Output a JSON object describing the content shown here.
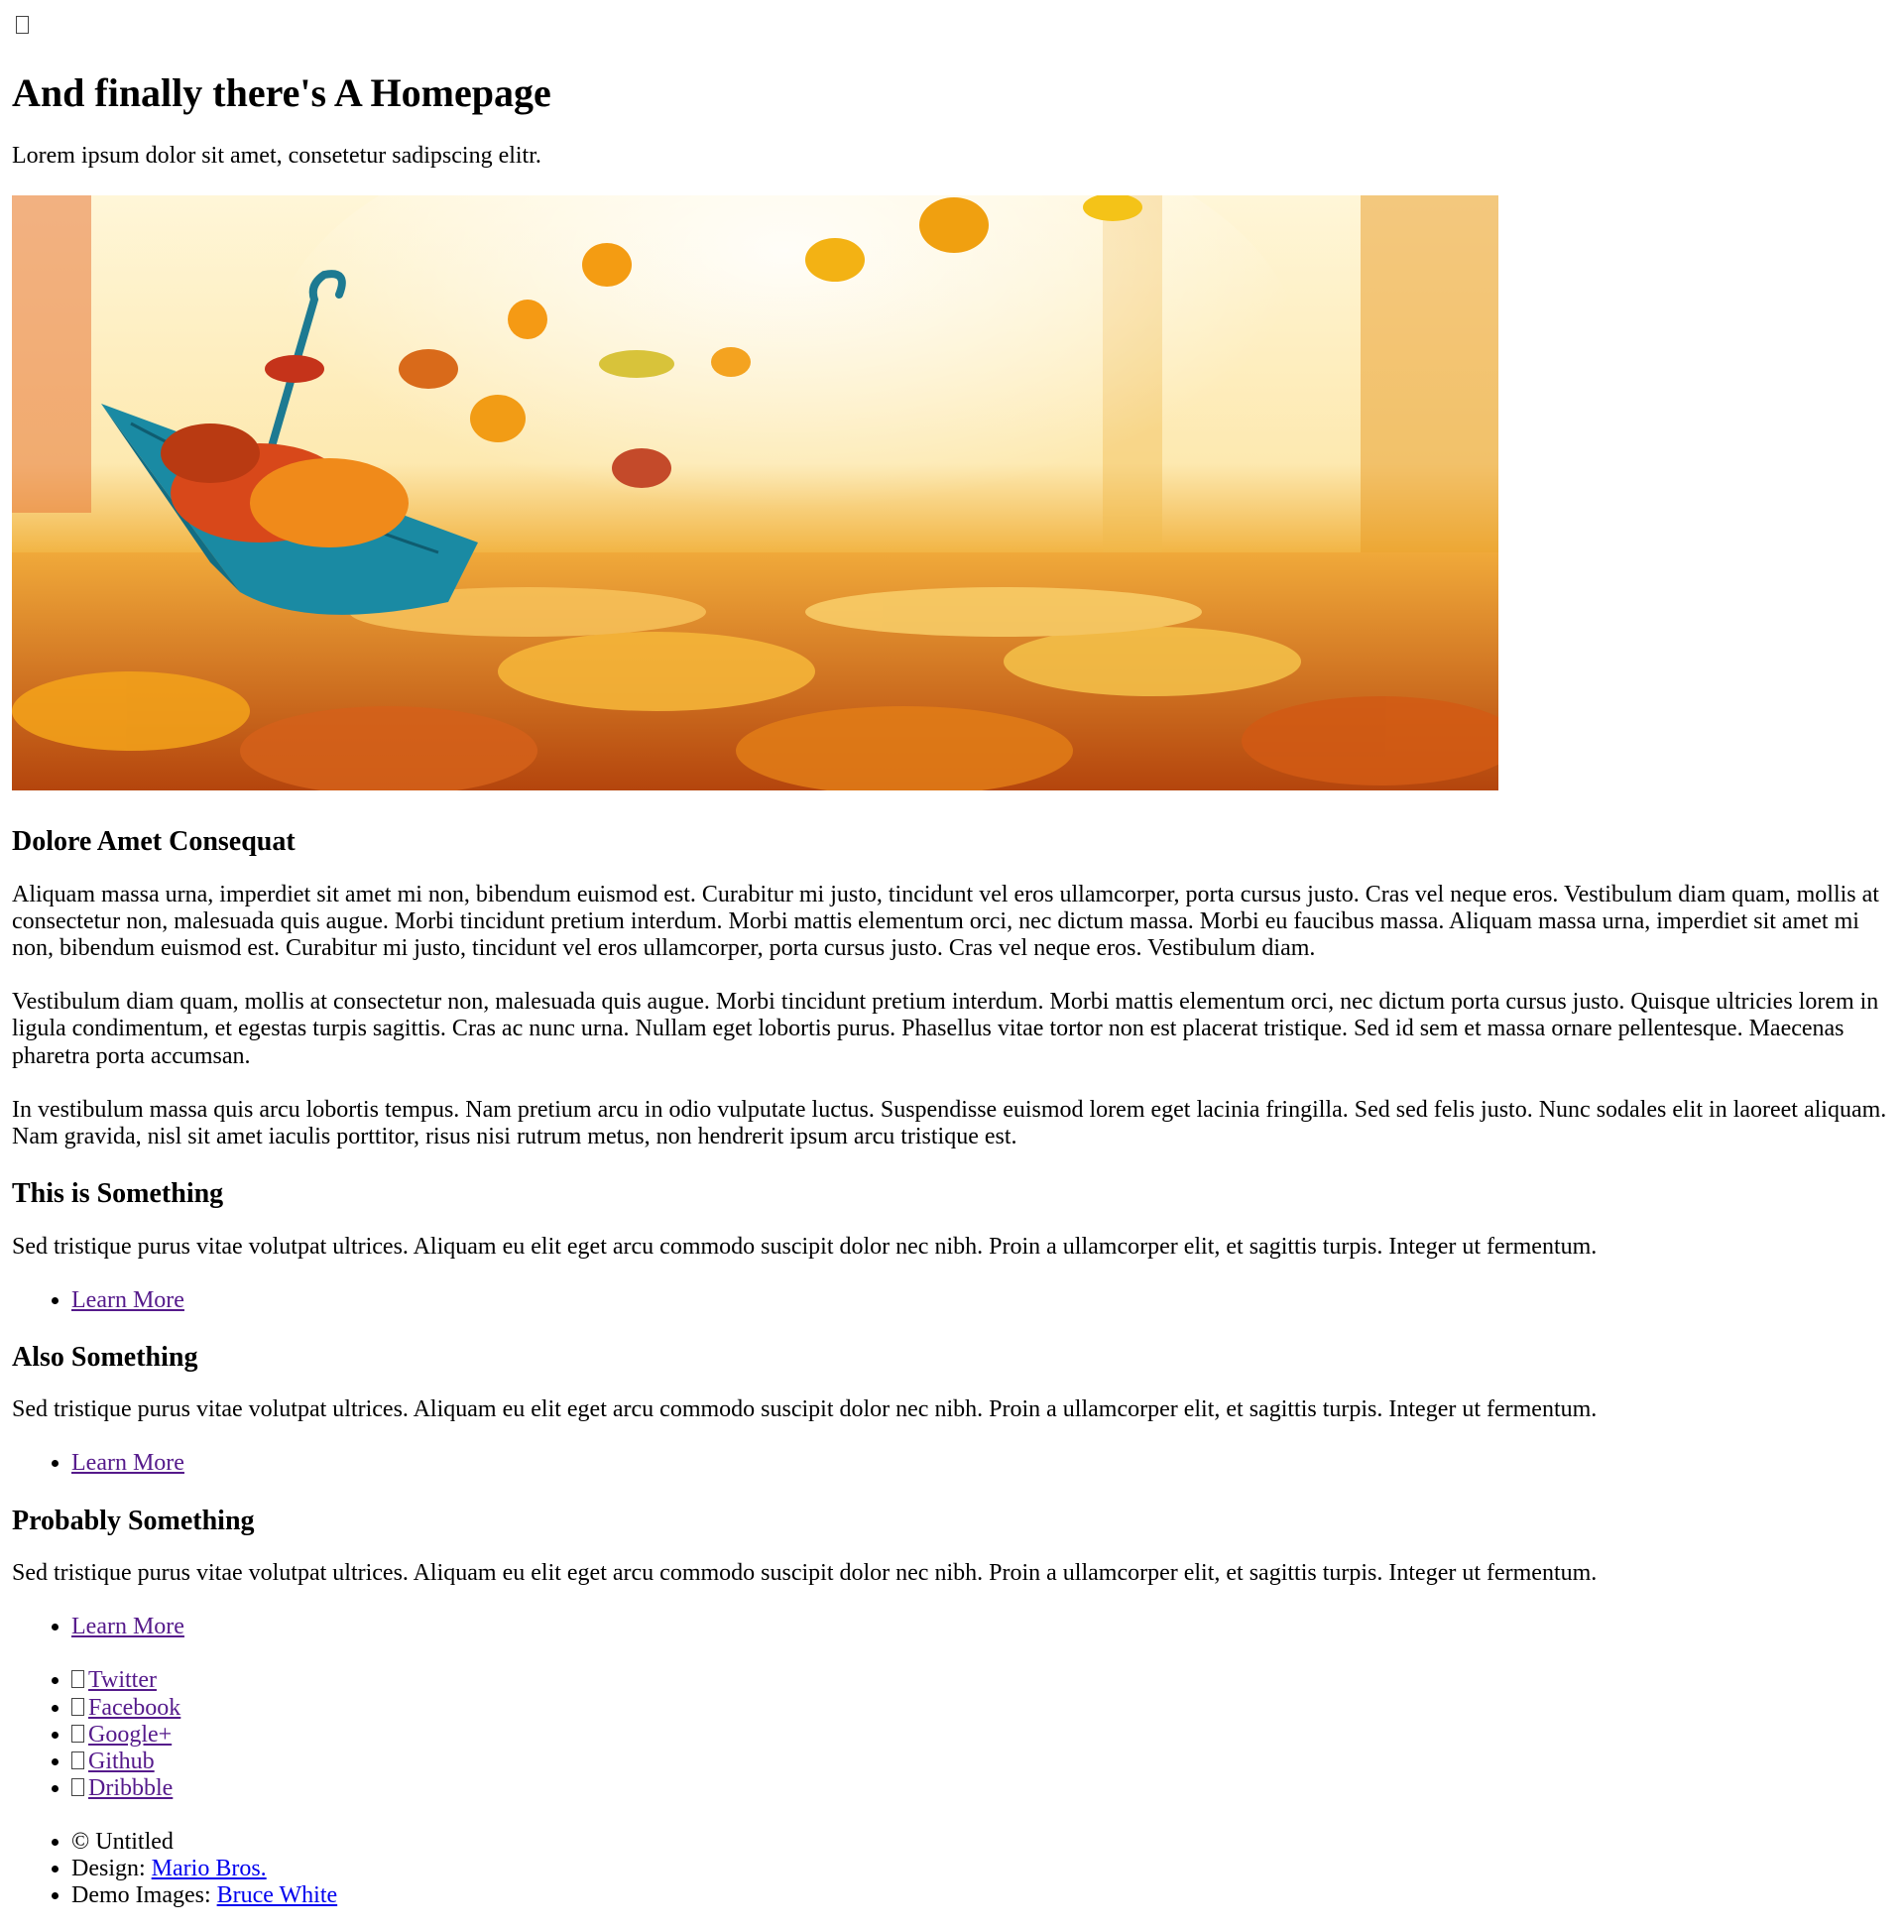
{
  "header": {
    "icon": "menu-icon",
    "title": "And finally there's A Homepage",
    "subtitle": "Lorem ipsum dolor sit amet, consetetur sadipscing elitr."
  },
  "banner": {
    "alt_icon": "autumn-umbrella-image",
    "colors": {
      "sky": "#fde9b0",
      "leaves": "#e58a1f",
      "umbrella": "#1a8aa3"
    }
  },
  "intro": {
    "heading": "Dolore Amet Consequat",
    "paragraphs": [
      "Aliquam massa urna, imperdiet sit amet mi non, bibendum euismod est. Curabitur mi justo, tincidunt vel eros ullamcorper, porta cursus justo. Cras vel neque eros. Vestibulum diam quam, mollis at consectetur non, malesuada quis augue. Morbi tincidunt pretium interdum. Morbi mattis elementum orci, nec dictum massa. Morbi eu faucibus massa. Aliquam massa urna, imperdiet sit amet mi non, bibendum euismod est. Curabitur mi justo, tincidunt vel eros ullamcorper, porta cursus justo. Cras vel neque eros. Vestibulum diam.",
      "Vestibulum diam quam, mollis at consectetur non, malesuada quis augue. Morbi tincidunt pretium interdum. Morbi mattis elementum orci, nec dictum porta cursus justo. Quisque ultricies lorem in ligula condimentum, et egestas turpis sagittis. Cras ac nunc urna. Nullam eget lobortis purus. Phasellus vitae tortor non est placerat tristique. Sed id sem et massa ornare pellentesque. Maecenas pharetra porta accumsan.",
      "In vestibulum massa quis arcu lobortis tempus. Nam pretium arcu in odio vulputate luctus. Suspendisse euismod lorem eget lacinia fringilla. Sed sed felis justo. Nunc sodales elit in laoreet aliquam. Nam gravida, nisl sit amet iaculis porttitor, risus nisi rutrum metus, non hendrerit ipsum arcu tristique est."
    ]
  },
  "features": [
    {
      "heading": "This is Something",
      "text": "Sed tristique purus vitae volutpat ultrices. Aliquam eu elit eget arcu commodo suscipit dolor nec nibh. Proin a ullamcorper elit, et sagittis turpis. Integer ut fermentum.",
      "link": "Learn More"
    },
    {
      "heading": "Also Something",
      "text": "Sed tristique purus vitae volutpat ultrices. Aliquam eu elit eget arcu commodo suscipit dolor nec nibh. Proin a ullamcorper elit, et sagittis turpis. Integer ut fermentum.",
      "link": "Learn More"
    },
    {
      "heading": "Probably Something",
      "text": "Sed tristique purus vitae volutpat ultrices. Aliquam eu elit eget arcu commodo suscipit dolor nec nibh. Proin a ullamcorper elit, et sagittis turpis. Integer ut fermentum.",
      "link": "Learn More"
    }
  ],
  "social": [
    {
      "label": "Twitter",
      "icon": "twitter-icon"
    },
    {
      "label": "Facebook",
      "icon": "facebook-icon"
    },
    {
      "label": "Google+",
      "icon": "google-plus-icon"
    },
    {
      "label": "Github",
      "icon": "github-icon"
    },
    {
      "label": "Dribbble",
      "icon": "dribbble-icon"
    }
  ],
  "footer": {
    "copyright": "© Untitled",
    "design_label": "Design: ",
    "design_link": "Mario Bros.",
    "images_label": "Demo Images: ",
    "images_link": "Bruce White"
  }
}
